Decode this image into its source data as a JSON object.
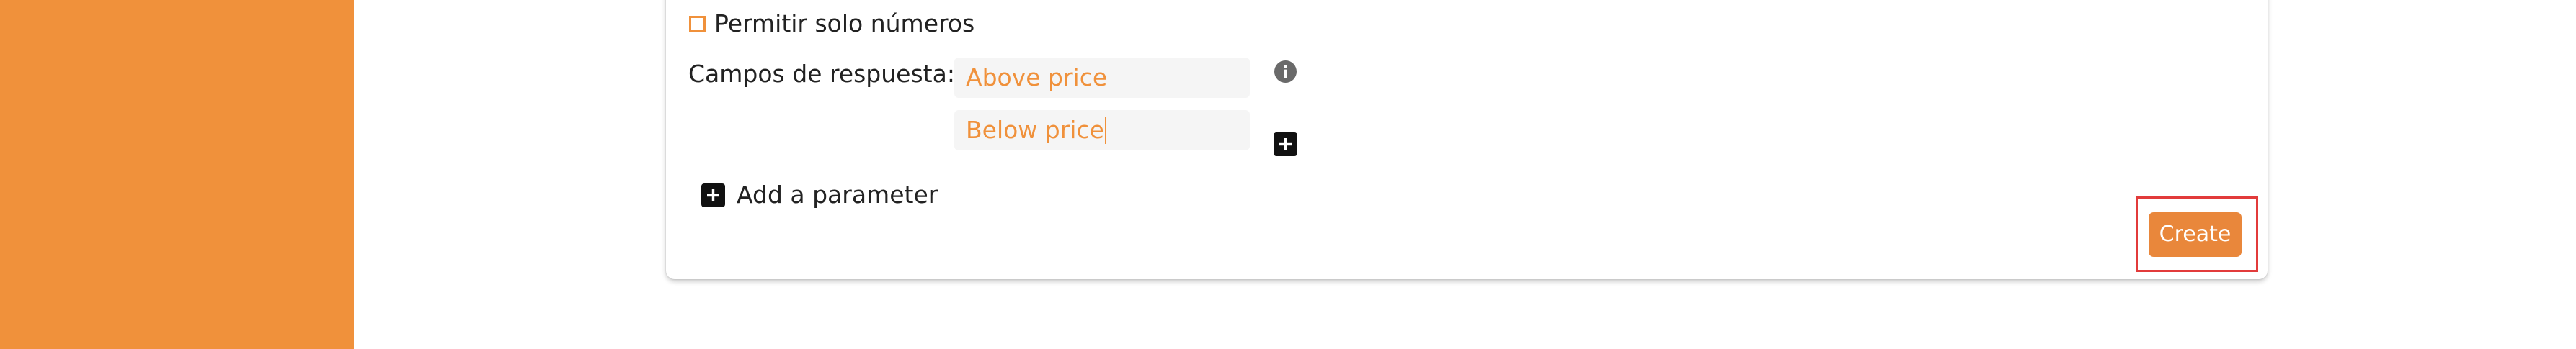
{
  "form": {
    "checkbox_label": "Permitir solo números",
    "response_fields_label": "Campos de respuesta:",
    "response_fields": [
      {
        "value": "Above price"
      },
      {
        "value": "Below price"
      }
    ],
    "add_parameter_label": "Add a parameter",
    "create_label": "Create"
  },
  "icons": {
    "info": "info-icon",
    "add_field": "plus-icon",
    "add_parameter": "plus-icon"
  },
  "colors": {
    "sidebar": "#f0913b",
    "accent": "#f0913b",
    "button": "#e9873b",
    "highlight": "#e23b3b"
  }
}
